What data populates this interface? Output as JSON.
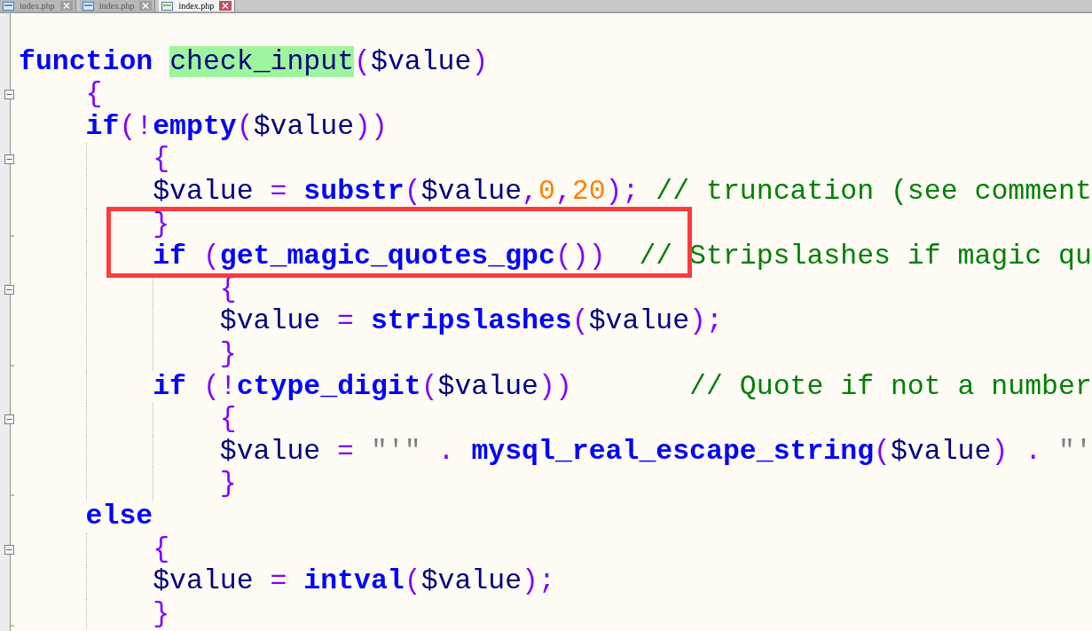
{
  "tabs": [
    {
      "label": "index.php",
      "selected": false
    },
    {
      "label": "index.php",
      "selected": false
    },
    {
      "label": "index.php",
      "selected": true
    }
  ],
  "code_lines": [
    {
      "collapsible": false,
      "block_end": false,
      "tokens": [
        {
          "kind": "keyword",
          "text": "function "
        },
        {
          "kind": "name",
          "text": "check_input",
          "highlighted": true
        },
        {
          "kind": "operator",
          "text": "("
        },
        {
          "kind": "variable",
          "text": "$value"
        },
        {
          "kind": "operator",
          "text": ")"
        }
      ],
      "children": [
        {
          "collapsible": true,
          "block_end": false,
          "tokens": [
            {
              "kind": "operator",
              "text": "{"
            }
          ]
        },
        {
          "collapsible": false,
          "block_end": false,
          "tokens": [
            {
              "kind": "keyword",
              "text": "if"
            },
            {
              "kind": "operator",
              "text": "(!"
            },
            {
              "kind": "keyword",
              "text": "empty"
            },
            {
              "kind": "operator",
              "text": "("
            },
            {
              "kind": "variable",
              "text": "$value"
            },
            {
              "kind": "operator",
              "text": "))"
            }
          ],
          "children": [
            {
              "collapsible": true,
              "block_end": false,
              "tokens": [
                {
                  "kind": "operator",
                  "text": "{"
                }
              ]
            },
            {
              "collapsible": false,
              "block_end": false,
              "tokens": [
                {
                  "kind": "variable",
                  "text": "$value"
                },
                {
                  "kind": "operator",
                  "text": " = "
                },
                {
                  "kind": "keyword",
                  "text": "substr"
                },
                {
                  "kind": "operator",
                  "text": "("
                },
                {
                  "kind": "variable",
                  "text": "$value"
                },
                {
                  "kind": "operator",
                  "text": ","
                },
                {
                  "kind": "number",
                  "text": "0"
                },
                {
                  "kind": "operator",
                  "text": ","
                },
                {
                  "kind": "number",
                  "text": "20"
                },
                {
                  "kind": "operator",
                  "text": ");"
                },
                {
                  "kind": "comment",
                  "text": " // truncation (see comment"
                }
              ]
            },
            {
              "collapsible": false,
              "block_end": true,
              "tokens": [
                {
                  "kind": "operator",
                  "text": "}"
                }
              ]
            },
            {
              "collapsible": false,
              "block_end": false,
              "tokens": [
                {
                  "kind": "keyword",
                  "text": "if "
                },
                {
                  "kind": "operator",
                  "text": "("
                },
                {
                  "kind": "keyword",
                  "text": "get_magic_quotes_gpc"
                },
                {
                  "kind": "operator",
                  "text": "())"
                },
                {
                  "kind": "comment",
                  "text": "  // Stripslashes if magic qu"
                }
              ],
              "children": [
                {
                  "collapsible": true,
                  "block_end": false,
                  "tokens": [
                    {
                      "kind": "operator",
                      "text": "{"
                    }
                  ]
                },
                {
                  "collapsible": false,
                  "block_end": false,
                  "tokens": [
                    {
                      "kind": "variable",
                      "text": "$value"
                    },
                    {
                      "kind": "operator",
                      "text": " = "
                    },
                    {
                      "kind": "keyword",
                      "text": "stripslashes"
                    },
                    {
                      "kind": "operator",
                      "text": "("
                    },
                    {
                      "kind": "variable",
                      "text": "$value"
                    },
                    {
                      "kind": "operator",
                      "text": ");"
                    }
                  ]
                },
                {
                  "collapsible": false,
                  "block_end": true,
                  "tokens": [
                    {
                      "kind": "operator",
                      "text": "}"
                    }
                  ]
                }
              ]
            },
            {
              "collapsible": false,
              "block_end": false,
              "tokens": [
                {
                  "kind": "keyword",
                  "text": "if "
                },
                {
                  "kind": "operator",
                  "text": "(!"
                },
                {
                  "kind": "keyword",
                  "text": "ctype_digit"
                },
                {
                  "kind": "operator",
                  "text": "("
                },
                {
                  "kind": "variable",
                  "text": "$value"
                },
                {
                  "kind": "operator",
                  "text": "))"
                },
                {
                  "kind": "comment",
                  "text": "       // Quote if not a number"
                }
              ],
              "children": [
                {
                  "collapsible": true,
                  "block_end": false,
                  "tokens": [
                    {
                      "kind": "operator",
                      "text": "{"
                    }
                  ]
                },
                {
                  "collapsible": false,
                  "block_end": false,
                  "tokens": [
                    {
                      "kind": "variable",
                      "text": "$value"
                    },
                    {
                      "kind": "operator",
                      "text": " = "
                    },
                    {
                      "kind": "string",
                      "text": "\"'\""
                    },
                    {
                      "kind": "operator",
                      "text": " . "
                    },
                    {
                      "kind": "keyword",
                      "text": "mysql_real_escape_string"
                    },
                    {
                      "kind": "operator",
                      "text": "("
                    },
                    {
                      "kind": "variable",
                      "text": "$value"
                    },
                    {
                      "kind": "operator",
                      "text": ") . "
                    },
                    {
                      "kind": "string",
                      "text": "\"'"
                    }
                  ]
                },
                {
                  "collapsible": false,
                  "block_end": true,
                  "tokens": [
                    {
                      "kind": "operator",
                      "text": "}"
                    }
                  ]
                }
              ]
            }
          ]
        },
        {
          "collapsible": false,
          "block_end": false,
          "tokens": [
            {
              "kind": "keyword",
              "text": "else"
            }
          ],
          "children": [
            {
              "collapsible": true,
              "block_end": false,
              "tokens": [
                {
                  "kind": "operator",
                  "text": "{"
                }
              ]
            },
            {
              "collapsible": false,
              "block_end": false,
              "tokens": [
                {
                  "kind": "variable",
                  "text": "$value"
                },
                {
                  "kind": "operator",
                  "text": " = "
                },
                {
                  "kind": "keyword",
                  "text": "intval"
                },
                {
                  "kind": "operator",
                  "text": "("
                },
                {
                  "kind": "variable",
                  "text": "$value"
                },
                {
                  "kind": "operator",
                  "text": ");"
                }
              ]
            },
            {
              "collapsible": false,
              "block_end": true,
              "tokens": [
                {
                  "kind": "operator",
                  "text": "}"
                }
              ]
            }
          ]
        }
      ]
    }
  ]
}
